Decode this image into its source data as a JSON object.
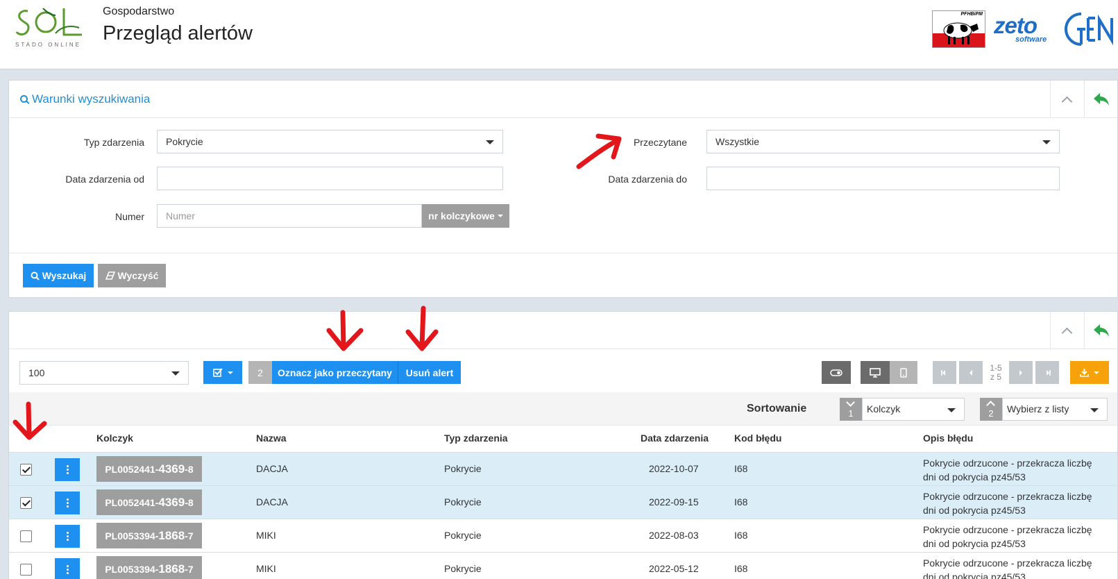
{
  "header": {
    "logo_sub": "STADO ONLINE",
    "farm_label": "Gospodarstwo",
    "page_title": "Przegląd alertów",
    "partner_logo_text": "PFHBiPM",
    "zeto": "zeto",
    "zeto_sub": "software"
  },
  "search": {
    "title": "Warunki wyszukiwania",
    "fields": {
      "event_type_label": "Typ zdarzenia",
      "event_type_value": "Pokrycie",
      "read_label": "Przeczytane",
      "read_value": "Wszystkie",
      "date_from_label": "Data zdarzenia od",
      "date_to_label": "Data zdarzenia do",
      "number_label": "Numer",
      "number_placeholder": "Numer",
      "number_type": "nr kolczykowe"
    },
    "search_button": "Wyszukaj",
    "clear_button": "Wyczyść"
  },
  "results": {
    "page_size": "100",
    "selected_count": "2",
    "mark_read_button": "Oznacz jako przeczytany",
    "delete_button": "Usuń alert",
    "pager_range": "1-5",
    "pager_total": "z 5",
    "sort_label": "Sortowanie",
    "sort1_index": "1",
    "sort1_value": "Kolczyk",
    "sort2_index": "2",
    "sort2_value": "Wybierz z listy",
    "columns": {
      "tag": "Kolczyk",
      "name": "Nazwa",
      "event_type": "Typ zdarzenia",
      "event_date": "Data zdarzenia",
      "error_code": "Kod błędu",
      "error_desc": "Opis błędu"
    },
    "rows": [
      {
        "tag_a": "PL0052441-",
        "tag_b": "4369",
        "tag_c": "-8",
        "name": "DACJA",
        "event_type": "Pokrycie",
        "date": "2022-10-07",
        "code": "I68",
        "desc1": "Pokrycie odrzucone - przekracza liczbę",
        "desc2": "dni od pokrycia pz45/53",
        "checked": true
      },
      {
        "tag_a": "PL0052441-",
        "tag_b": "4369",
        "tag_c": "-8",
        "name": "DACJA",
        "event_type": "Pokrycie",
        "date": "2022-09-15",
        "code": "I68",
        "desc1": "Pokrycie odrzucone - przekracza liczbę",
        "desc2": "dni od pokrycia pz45/53",
        "checked": true
      },
      {
        "tag_a": "PL0053394-",
        "tag_b": "1868",
        "tag_c": "-7",
        "name": "MIKI",
        "event_type": "Pokrycie",
        "date": "2022-08-03",
        "code": "I68",
        "desc1": "Pokrycie odrzucone - przekracza liczbę",
        "desc2": "dni od pokrycia pz45/53",
        "checked": false
      },
      {
        "tag_a": "PL0053394-",
        "tag_b": "1868",
        "tag_c": "-7",
        "name": "MIKI",
        "event_type": "Pokrycie",
        "date": "2022-05-12",
        "code": "I68",
        "desc1": "Pokrycie odrzucone - przekracza liczbę",
        "desc2": "dni od pokrycia pz45/53",
        "checked": false
      }
    ]
  },
  "colors": {
    "primary": "#1e90f0",
    "gray_button": "#9e9e9e",
    "orange": "#f7a20a",
    "back_green": "#2ea84a",
    "selected_row": "#dbeef8",
    "annotation": "#e3161b"
  }
}
